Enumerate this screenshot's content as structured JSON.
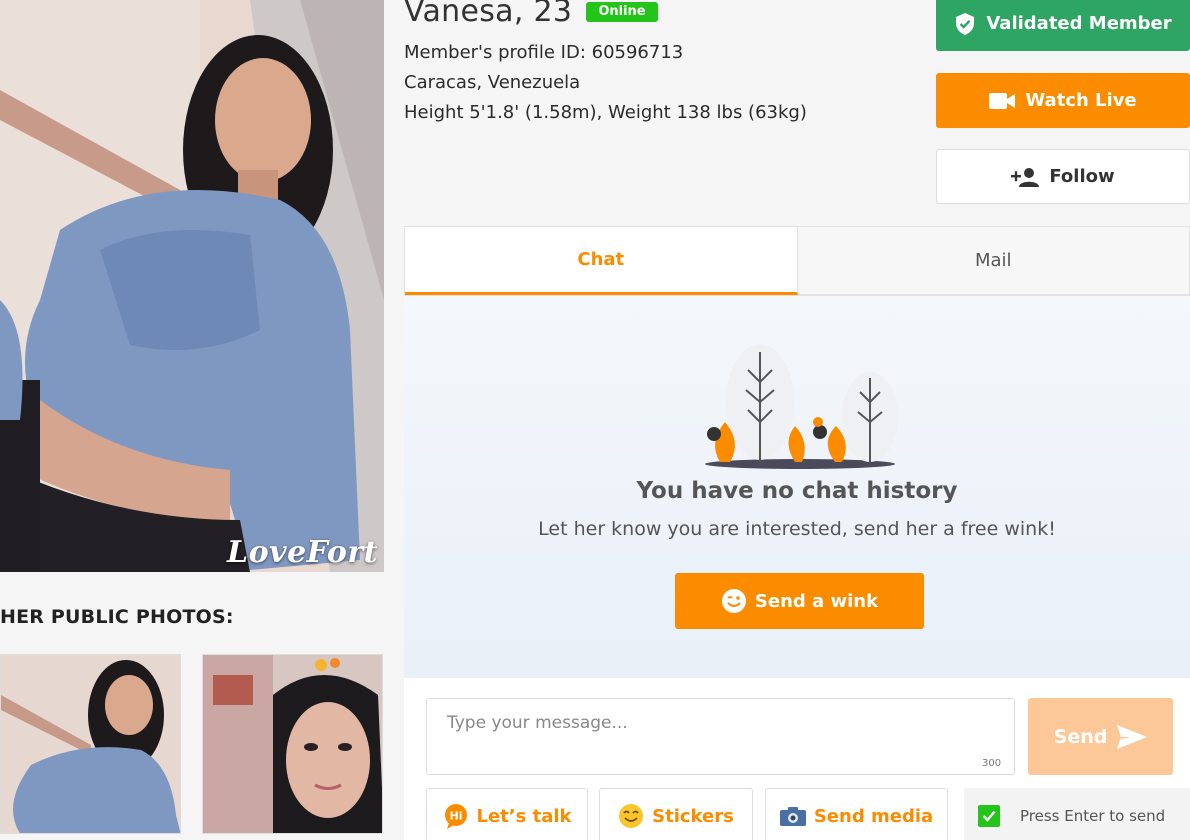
{
  "profile": {
    "name": "Vanesa, 23",
    "status": "Online",
    "profile_id": "Member's profile ID: 60596713",
    "location": "Caracas, Venezuela",
    "body": "Height 5'1.8' (1.58m), Weight 138 lbs (63kg)"
  },
  "photo": {
    "watermark": "LoveFort"
  },
  "public_photos": {
    "heading": "HER PUBLIC PHOTOS:"
  },
  "actions": {
    "validated": "Validated Member",
    "watch_live": "Watch Live",
    "follow": "Follow"
  },
  "tabs": [
    {
      "label": "Chat",
      "active": true
    },
    {
      "label": "Mail",
      "active": false
    }
  ],
  "chat": {
    "empty_title": "You have no chat history",
    "empty_subtitle": "Let her know you are interested, send her a free wink!",
    "wink_button": "Send a wink"
  },
  "compose": {
    "placeholder": "Type your message...",
    "char_limit": "300",
    "send": "Send",
    "lets_talk": "Let’s talk",
    "stickers": "Stickers",
    "send_media": "Send media",
    "press_enter": "Press Enter to send",
    "press_enter_checked": true
  },
  "colors": {
    "accent": "#fb8c00",
    "validated": "#2fa563",
    "online": "#25c41a",
    "send_disabled": "#fdc897"
  },
  "icons": [
    "shield-check-icon",
    "video-camera-icon",
    "person-add-icon",
    "wink-face-icon",
    "send-arrow-icon",
    "hi-bubble-icon",
    "sticker-face-icon",
    "camera-icon",
    "checkmark-icon"
  ]
}
